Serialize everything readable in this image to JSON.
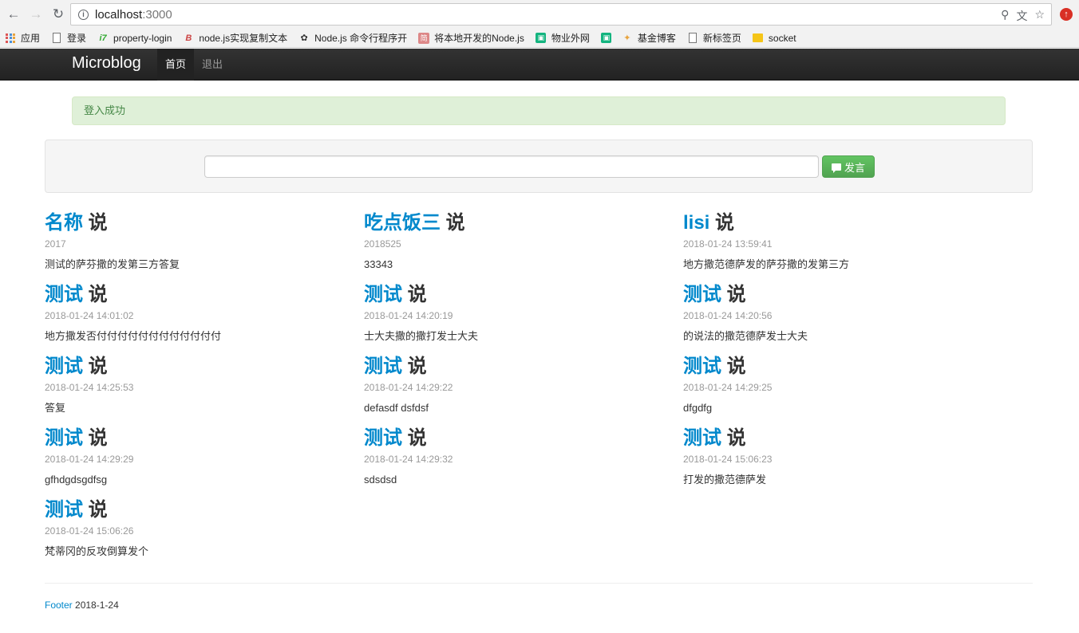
{
  "browser": {
    "url_host": "localhost",
    "url_port": ":3000",
    "bookmarks": [
      {
        "label": "应用",
        "icon": "apps-grid-icon"
      },
      {
        "label": "登录",
        "icon": "page-icon"
      },
      {
        "label": "property-login",
        "icon": "favicon-icon"
      },
      {
        "label": "node.js实现复制文本",
        "icon": "favicon-icon"
      },
      {
        "label": "Node.js 命令行程序开",
        "icon": "favicon-icon"
      },
      {
        "label": "将本地开发的Node.js",
        "icon": "favicon-icon"
      },
      {
        "label": "物业外网",
        "icon": "green-favicon-icon"
      },
      {
        "label": "",
        "icon": "green-favicon-icon"
      },
      {
        "label": "基金博客",
        "icon": "favicon-icon"
      },
      {
        "label": "新标签页",
        "icon": "page-icon"
      },
      {
        "label": "socket",
        "icon": "folder-icon"
      }
    ]
  },
  "navbar": {
    "brand": "Microblog",
    "items": [
      {
        "label": "首页",
        "active": true
      },
      {
        "label": "退出",
        "active": false
      }
    ]
  },
  "alert": {
    "message": "登入成功"
  },
  "composer": {
    "button_label": "发言",
    "input_value": ""
  },
  "posts": [
    {
      "user": "名称",
      "verb": "说",
      "time": "2017",
      "text": "测试的萨芬撒的发第三方答复"
    },
    {
      "user": "吃点饭三",
      "verb": "说",
      "time": "2018525",
      "text": "33343"
    },
    {
      "user": "lisi",
      "verb": "说",
      "time": "2018-01-24 13:59:41",
      "text": "地方撒范德萨发的萨芬撒的发第三方"
    },
    {
      "user": "测试",
      "verb": "说",
      "time": "2018-01-24 14:01:02",
      "text": "地方撒发否付付付付付付付付付付付付"
    },
    {
      "user": "测试",
      "verb": "说",
      "time": "2018-01-24 14:20:19",
      "text": "士大夫撒的撒打发士大夫"
    },
    {
      "user": "测试",
      "verb": "说",
      "time": "2018-01-24 14:20:56",
      "text": "的说法的撒范德萨发士大夫"
    },
    {
      "user": "测试",
      "verb": "说",
      "time": "2018-01-24 14:25:53",
      "text": "答复"
    },
    {
      "user": "测试",
      "verb": "说",
      "time": "2018-01-24 14:29:22",
      "text": "defasdf dsfdsf"
    },
    {
      "user": "测试",
      "verb": "说",
      "time": "2018-01-24 14:29:25",
      "text": "dfgdfg"
    },
    {
      "user": "测试",
      "verb": "说",
      "time": "2018-01-24 14:29:29",
      "text": "gfhdgdsgdfsg"
    },
    {
      "user": "测试",
      "verb": "说",
      "time": "2018-01-24 14:29:32",
      "text": "sdsdsd"
    },
    {
      "user": "测试",
      "verb": "说",
      "time": "2018-01-24 15:06:23",
      "text": "打发的撒范德萨发"
    },
    {
      "user": "测试",
      "verb": "说",
      "time": "2018-01-24 15:06:26",
      "text": "梵蒂冈的反攻倒算发个"
    }
  ],
  "footer": {
    "link": "Footer",
    "date": "2018-1-24"
  }
}
